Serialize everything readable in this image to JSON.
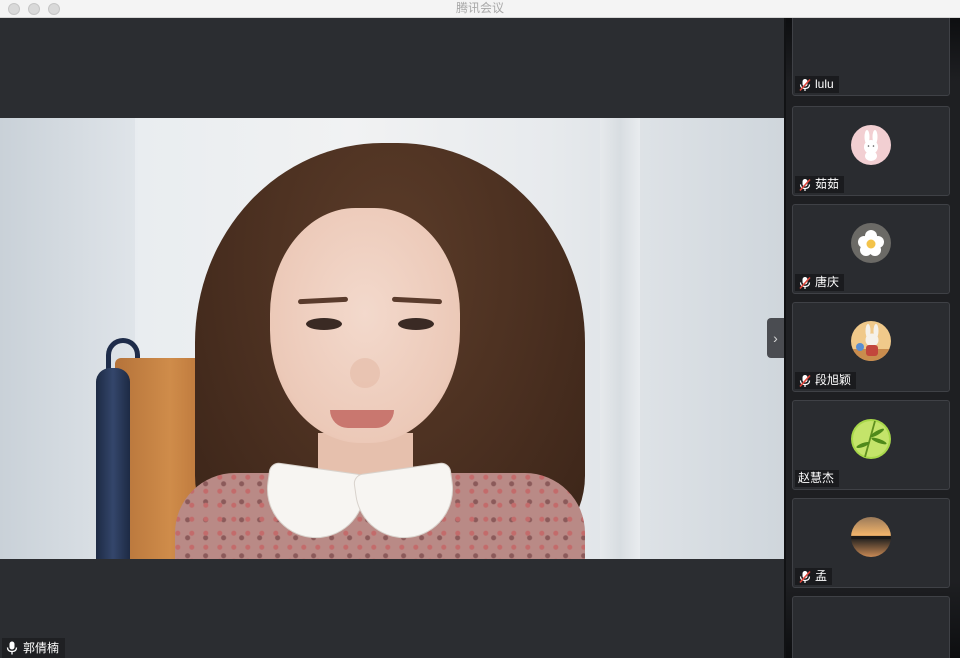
{
  "window": {
    "title": "腾讯会议"
  },
  "main": {
    "speaker_name": "郭倩楠",
    "speaker_mic": "mic-icon"
  },
  "sidebar": {
    "collapse_icon": "chevron-right-icon",
    "participants": [
      {
        "name": "lulu",
        "mic": "mic-muted-icon",
        "avatar": ""
      },
      {
        "name": "茹茹",
        "mic": "mic-muted-icon",
        "avatar": "rabbit-avatar"
      },
      {
        "name": "唐庆",
        "mic": "mic-muted-icon",
        "avatar": "flower-avatar"
      },
      {
        "name": "段旭颖",
        "mic": "mic-muted-icon",
        "avatar": "cartoon-rabbit-avatar"
      },
      {
        "name": "赵慧杰",
        "mic": "",
        "avatar": "bamboo-avatar"
      },
      {
        "name": "孟",
        "mic": "mic-muted-icon",
        "avatar": "sunset-avatar"
      }
    ]
  },
  "colors": {
    "background": "#2b2d31",
    "sidebar": "#1e1f22",
    "tile": "#2a2c30",
    "muted_red": "#e0473c"
  }
}
